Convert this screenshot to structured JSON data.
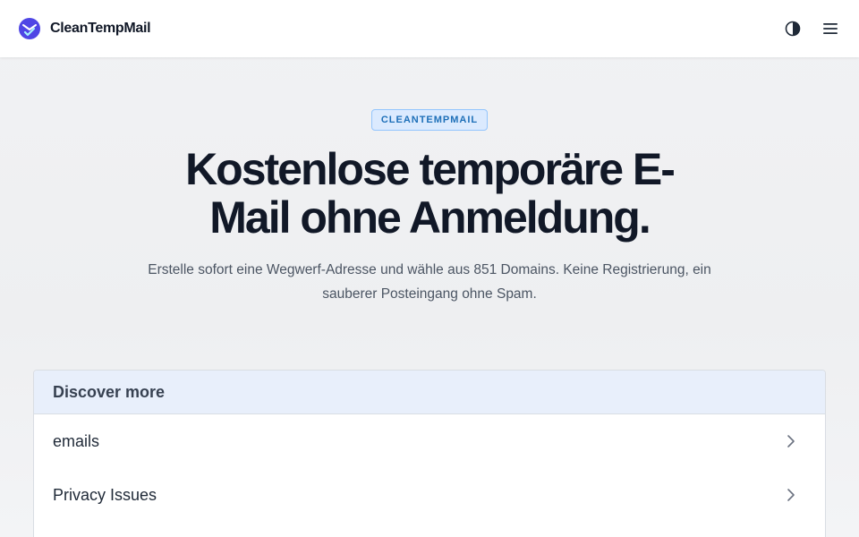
{
  "header": {
    "brand_name": "CleanTempMail",
    "logo_icon": "clean-mail-logo-icon",
    "theme_toggle_icon": "contrast-icon",
    "menu_icon": "hamburger-menu-icon"
  },
  "hero": {
    "badge": "CLEANTEMPMAIL",
    "title": "Kostenlose temporäre E-Mail ohne Anmeldung.",
    "subtitle": "Erstelle sofort eine Wegwerf-Adresse und wähle aus 851 Domains. Keine Registrierung, ein sauberer Posteingang ohne Spam."
  },
  "discover": {
    "title": "Discover more",
    "items": [
      {
        "label": "emails"
      },
      {
        "label": "Privacy Issues"
      }
    ]
  },
  "colors": {
    "accent": "#4f46e5",
    "badge_bg": "#dbeafe",
    "badge_text": "#1d6fb8",
    "card_header_bg": "#e8effb"
  }
}
